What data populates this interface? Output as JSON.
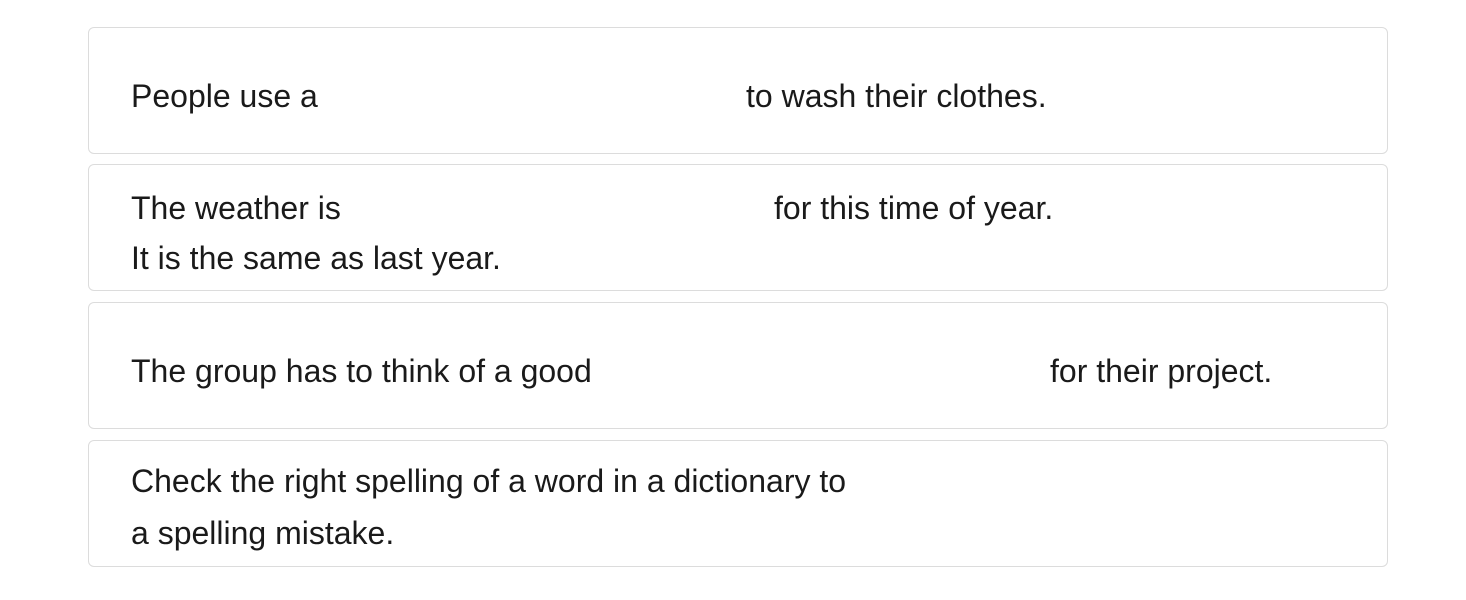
{
  "questions": [
    {
      "before": "People use a",
      "after": "to wash their clothes.",
      "answer": ""
    },
    {
      "before": "The weather is",
      "after": "for this time of year.",
      "line2": "It is the same as last year.",
      "answer": ""
    },
    {
      "before": "The group has to think of a good",
      "after": "for their project.",
      "answer": ""
    },
    {
      "before": "Check the right spelling of a word in a dictionary to",
      "line2": "a spelling mistake.",
      "answer": ""
    }
  ]
}
